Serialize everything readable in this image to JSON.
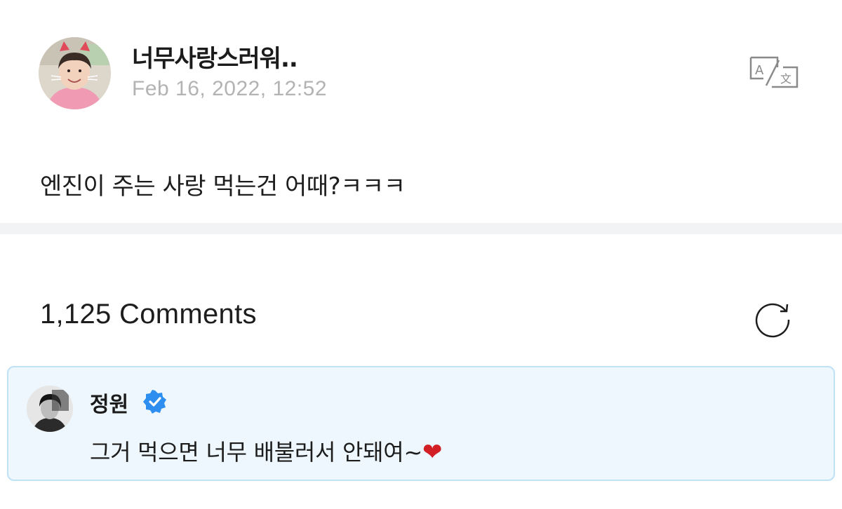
{
  "post": {
    "author_name": "너무사랑스러워..",
    "date": "Feb 16, 2022, 12:52",
    "body": "엔진이 주는 사랑 먹는건 어때?ㅋㅋㅋ",
    "avatar_icon": "cat-filter-avatar",
    "translate_icon": "translate-icon"
  },
  "comments": {
    "count_label": "1,125 Comments",
    "refresh_icon": "refresh-icon",
    "items": [
      {
        "author": "정원",
        "verified": true,
        "text": "그거 먹으면 너무 배불러서 안돼여~",
        "emoji": "❤"
      }
    ]
  },
  "colors": {
    "highlight_bg": "#eef7fd",
    "highlight_border": "#bfe2f6",
    "verified": "#2d8ef0",
    "date_gray": "#b3b3b3",
    "divider": "#f2f3f5"
  }
}
